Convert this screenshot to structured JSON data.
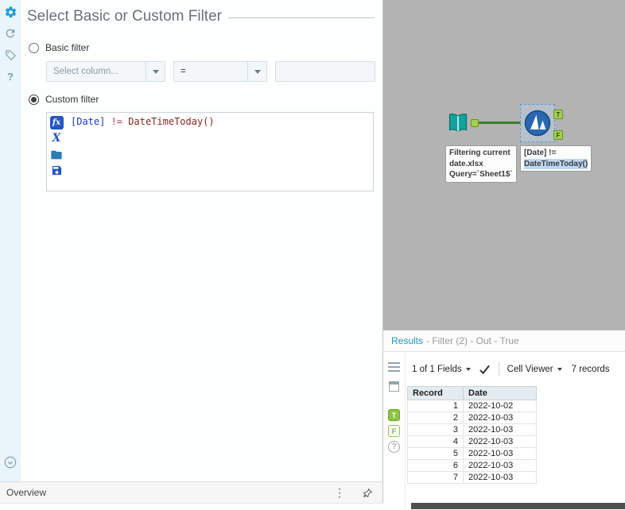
{
  "config": {
    "title": "Select Basic or Custom Filter",
    "basic_filter_label": "Basic filter",
    "custom_filter_label": "Custom filter",
    "column_placeholder": "Select column...",
    "operator_value": "=",
    "expression": {
      "column": "[Date]",
      "operator": " != ",
      "function": "DateTimeToday()"
    }
  },
  "overview": {
    "label": "Overview"
  },
  "canvas": {
    "input_annotation": "Filtering current\ndate.xlsx\nQuery=`Sheet1$`",
    "filter_annotation_line1": "[Date] !=",
    "filter_annotation_line2": "DateTimeToday()",
    "true_anchor": "T",
    "false_anchor": "F"
  },
  "results": {
    "title": "Results",
    "subtitle": "- Filter (2) - Out - True",
    "toolbar": {
      "fields": "1 of 1 Fields",
      "cell_viewer": "Cell Viewer",
      "records": "7 records"
    },
    "strip": {
      "true": "T",
      "false": "F",
      "help": "?"
    },
    "table": {
      "columns": [
        "Record",
        "Date"
      ],
      "rows": [
        [
          "1",
          "2022-10-02"
        ],
        [
          "2",
          "2022-10-03"
        ],
        [
          "3",
          "2022-10-03"
        ],
        [
          "4",
          "2022-10-03"
        ],
        [
          "5",
          "2022-10-03"
        ],
        [
          "6",
          "2022-10-03"
        ],
        [
          "7",
          "2022-10-03"
        ]
      ]
    }
  },
  "icons": {
    "fx": "fx",
    "x_var": "X",
    "help": "?",
    "ellipsis": "⋮"
  },
  "colors": {
    "accent_blue": "#1e9cd7",
    "anchor_green": "#8dc63f",
    "connection_green": "#37822a",
    "results_title": "#2596be",
    "canvas_gray": "#b3b3b3"
  }
}
